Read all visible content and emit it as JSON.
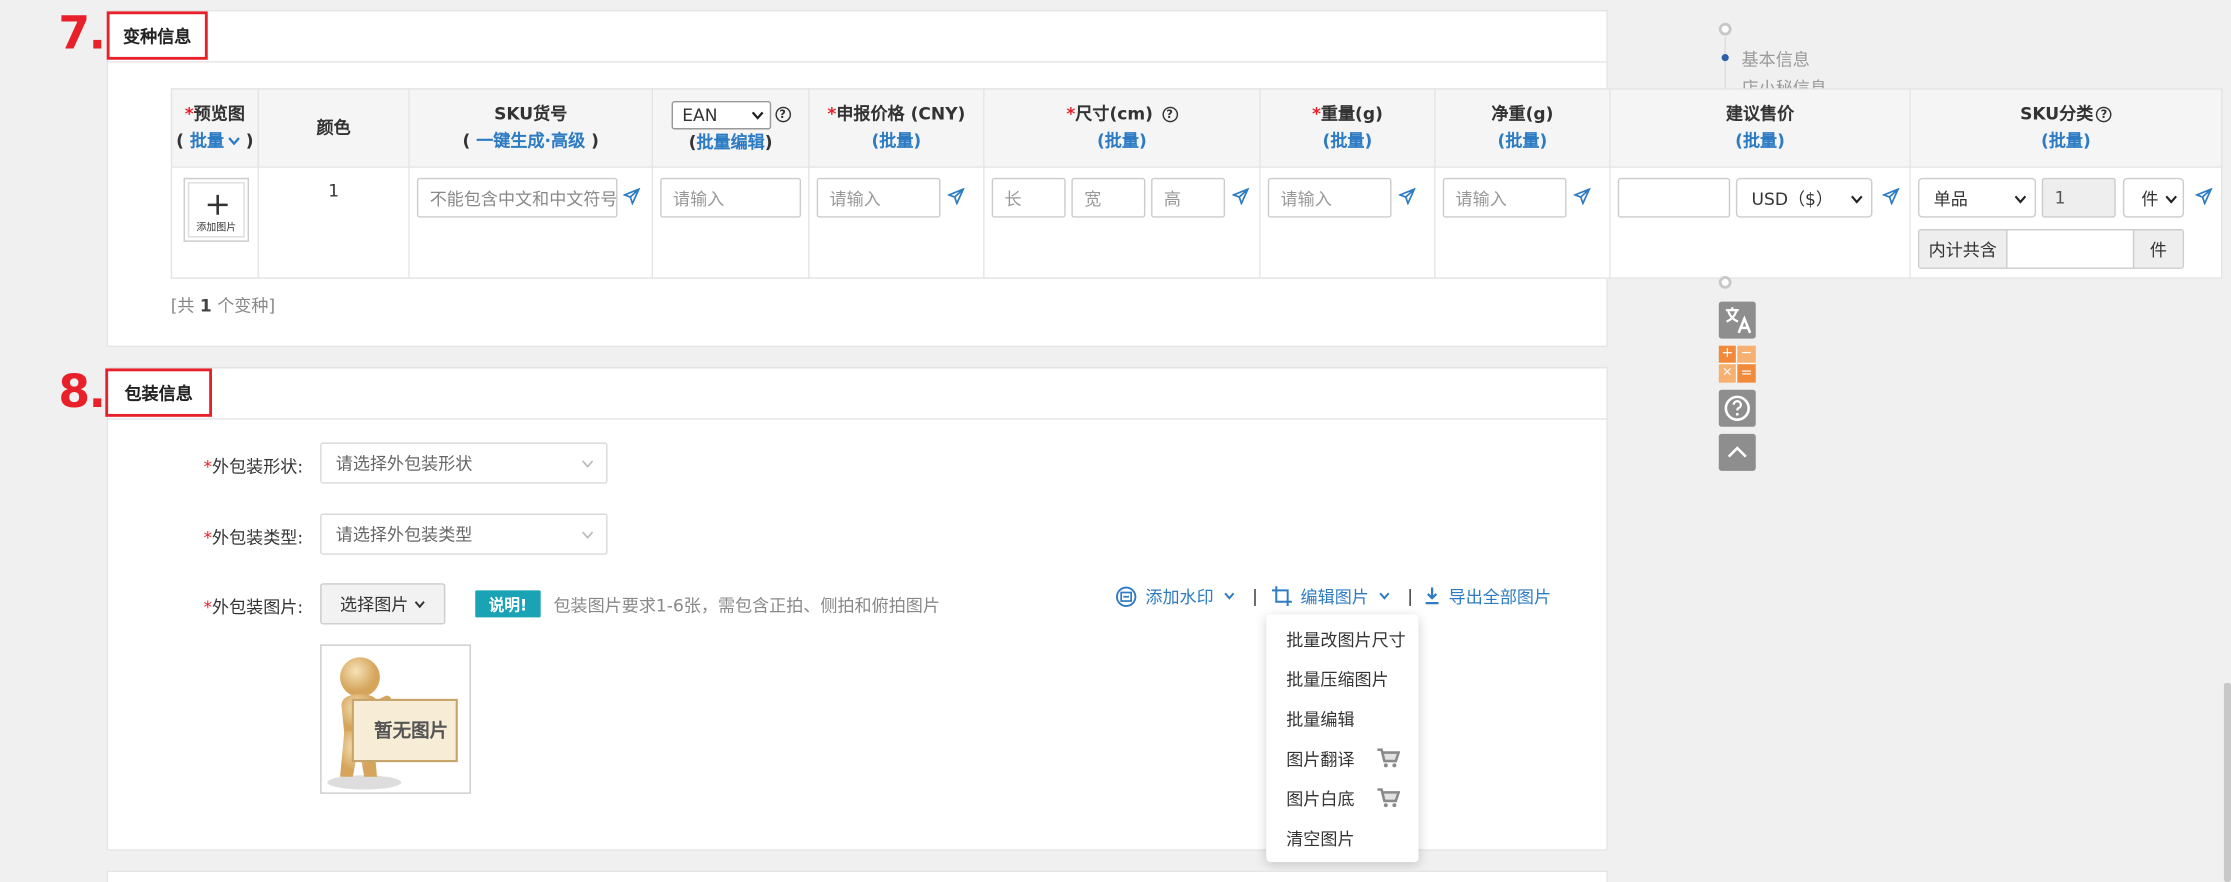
{
  "section7": {
    "number": "7.",
    "title": "变种信息"
  },
  "section8": {
    "number": "8.",
    "title": "包装信息"
  },
  "table": {
    "headers": {
      "preview_req": "*",
      "preview": "预览图",
      "preview_batch": "批量",
      "color": "颜色",
      "sku": "SKU货号",
      "sku_sub_paren_open": "(",
      "sku_gen": "一键生成",
      "sku_dot": "·",
      "sku_adv": "高级",
      "sku_sub_paren_close": ")",
      "ean_select": "EAN",
      "ean_batch": "批量编辑",
      "price_req": "*",
      "price": "申报价格 (CNY)",
      "price_batch": "(批量)",
      "size_req": "*",
      "size": "尺寸(cm)",
      "size_batch": "(批量)",
      "weight_req": "*",
      "weight": "重量(g)",
      "weight_batch": "(批量)",
      "net": "净重(g)",
      "net_batch": "(批量)",
      "suggest": "建议售价",
      "suggest_batch": "(批量)",
      "skucat": "SKU分类",
      "skucat_batch": "(批量)"
    },
    "row": {
      "add_image": "添加图片",
      "color_value": "1",
      "sku_placeholder": "不能包含中文和中文符号",
      "ean_placeholder": "请输入",
      "price_placeholder": "请输入",
      "len_placeholder": "长",
      "wid_placeholder": "宽",
      "hei_placeholder": "高",
      "weight_placeholder": "请输入",
      "net_placeholder": "请输入",
      "currency": "USD（$）",
      "sku_type": "单品",
      "qty": "1",
      "unit": "件",
      "inner_label": "内计共含",
      "inner_unit": "件"
    },
    "count_text_pre": "[共 ",
    "count": "1",
    "count_text_post": " 个变种]"
  },
  "packaging": {
    "shape_label": "外包装形状:",
    "shape_placeholder": "请选择外包装形状",
    "type_label": "外包装类型:",
    "type_placeholder": "请选择外包装类型",
    "image_label": "外包装图片:",
    "choose_button": "选择图片",
    "note_badge": "说明!",
    "note_text": "包装图片要求1-6张，需包含正拍、侧拍和俯拍图片",
    "no_image": "暂无图片",
    "req": "*"
  },
  "toolbar": {
    "watermark": "添加水印",
    "edit_image": "编辑图片",
    "sep": "|",
    "export": "导出全部图片"
  },
  "edit_menu": [
    "批量改图片尺寸",
    "批量压缩图片",
    "批量编辑",
    "图片翻译",
    "图片白底",
    "清空图片"
  ],
  "side_nav": {
    "item1": "基本信息",
    "item2": "店小秘信息"
  },
  "colors": {
    "accent": "#2d7bc3",
    "required": "#e8202a",
    "badge": "#1aa3b5",
    "calc": "#f28a3c",
    "icon_gray": "#8e8e8e"
  }
}
